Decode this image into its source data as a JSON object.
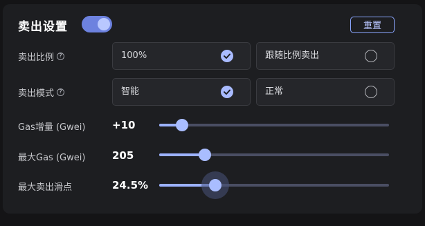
{
  "header": {
    "title": "卖出设置",
    "toggle_on": true,
    "reset_label": "重置"
  },
  "sell_ratio": {
    "label": "卖出比例",
    "help_icon": "question-circle-icon",
    "options": [
      {
        "label": "100%",
        "checked": true
      },
      {
        "label": "跟随比例卖出",
        "checked": false
      }
    ]
  },
  "sell_mode": {
    "label": "卖出模式",
    "help_icon": "question-circle-icon",
    "options": [
      {
        "label": "智能",
        "checked": true
      },
      {
        "label": "正常",
        "checked": false
      }
    ]
  },
  "sliders": [
    {
      "label": "Gas增量 (Gwei)",
      "value": "+10",
      "level": 0.1
    },
    {
      "label": "最大Gas (Gwei)",
      "value": "205",
      "level": 0.2
    },
    {
      "label": "最大卖出滑点",
      "value": "24.5%",
      "level": 0.245
    }
  ],
  "colors": {
    "accent": "#a9bdff",
    "toggle": "#6d82df",
    "track": "#4a4e63"
  }
}
